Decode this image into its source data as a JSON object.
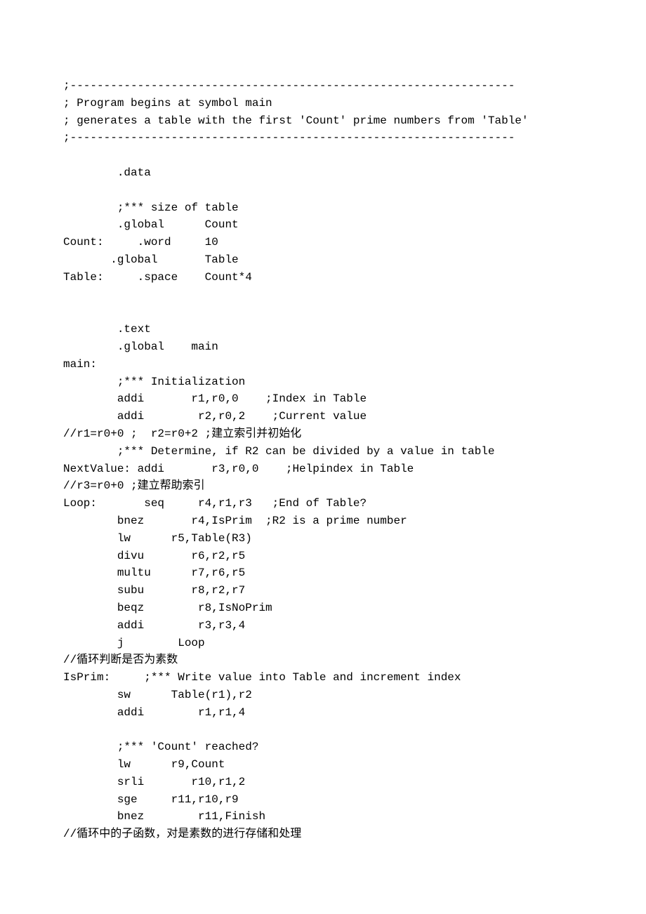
{
  "lines": [
    ";------------------------------------------------------------------",
    "; Program begins at symbol main",
    "; generates a table with the first 'Count' prime numbers from 'Table'",
    ";------------------------------------------------------------------",
    "",
    "        .data",
    "",
    "        ;*** size of table",
    "        .global      Count",
    "Count:     .word     10",
    "       .global       Table",
    "Table:     .space    Count*4",
    "",
    "",
    "        .text",
    "        .global    main",
    "main:",
    "        ;*** Initialization",
    "        addi       r1,r0,0    ;Index in Table",
    "        addi        r2,r0,2    ;Current value",
    "//r1=r0+0 ;  r2=r0+2 ;建立索引并初始化",
    "        ;*** Determine, if R2 can be divided by a value in table",
    "NextValue: addi       r3,r0,0    ;Helpindex in Table",
    "//r3=r0+0 ;建立帮助索引",
    "Loop:       seq     r4,r1,r3   ;End of Table?",
    "        bnez       r4,IsPrim  ;R2 is a prime number",
    "        lw      r5,Table(R3)",
    "        divu       r6,r2,r5",
    "        multu      r7,r6,r5",
    "        subu       r8,r2,r7",
    "        beqz        r8,IsNoPrim",
    "        addi        r3,r3,4",
    "        j        Loop",
    "//循环判断是否为素数",
    "IsPrim:     ;*** Write value into Table and increment index",
    "        sw      Table(r1),r2",
    "        addi        r1,r1,4",
    "",
    "        ;*** 'Count' reached?",
    "        lw      r9,Count",
    "        srli       r10,r1,2",
    "        sge     r11,r10,r9",
    "        bnez        r11,Finish",
    "//循环中的子函数，对是素数的进行存储和处理"
  ]
}
